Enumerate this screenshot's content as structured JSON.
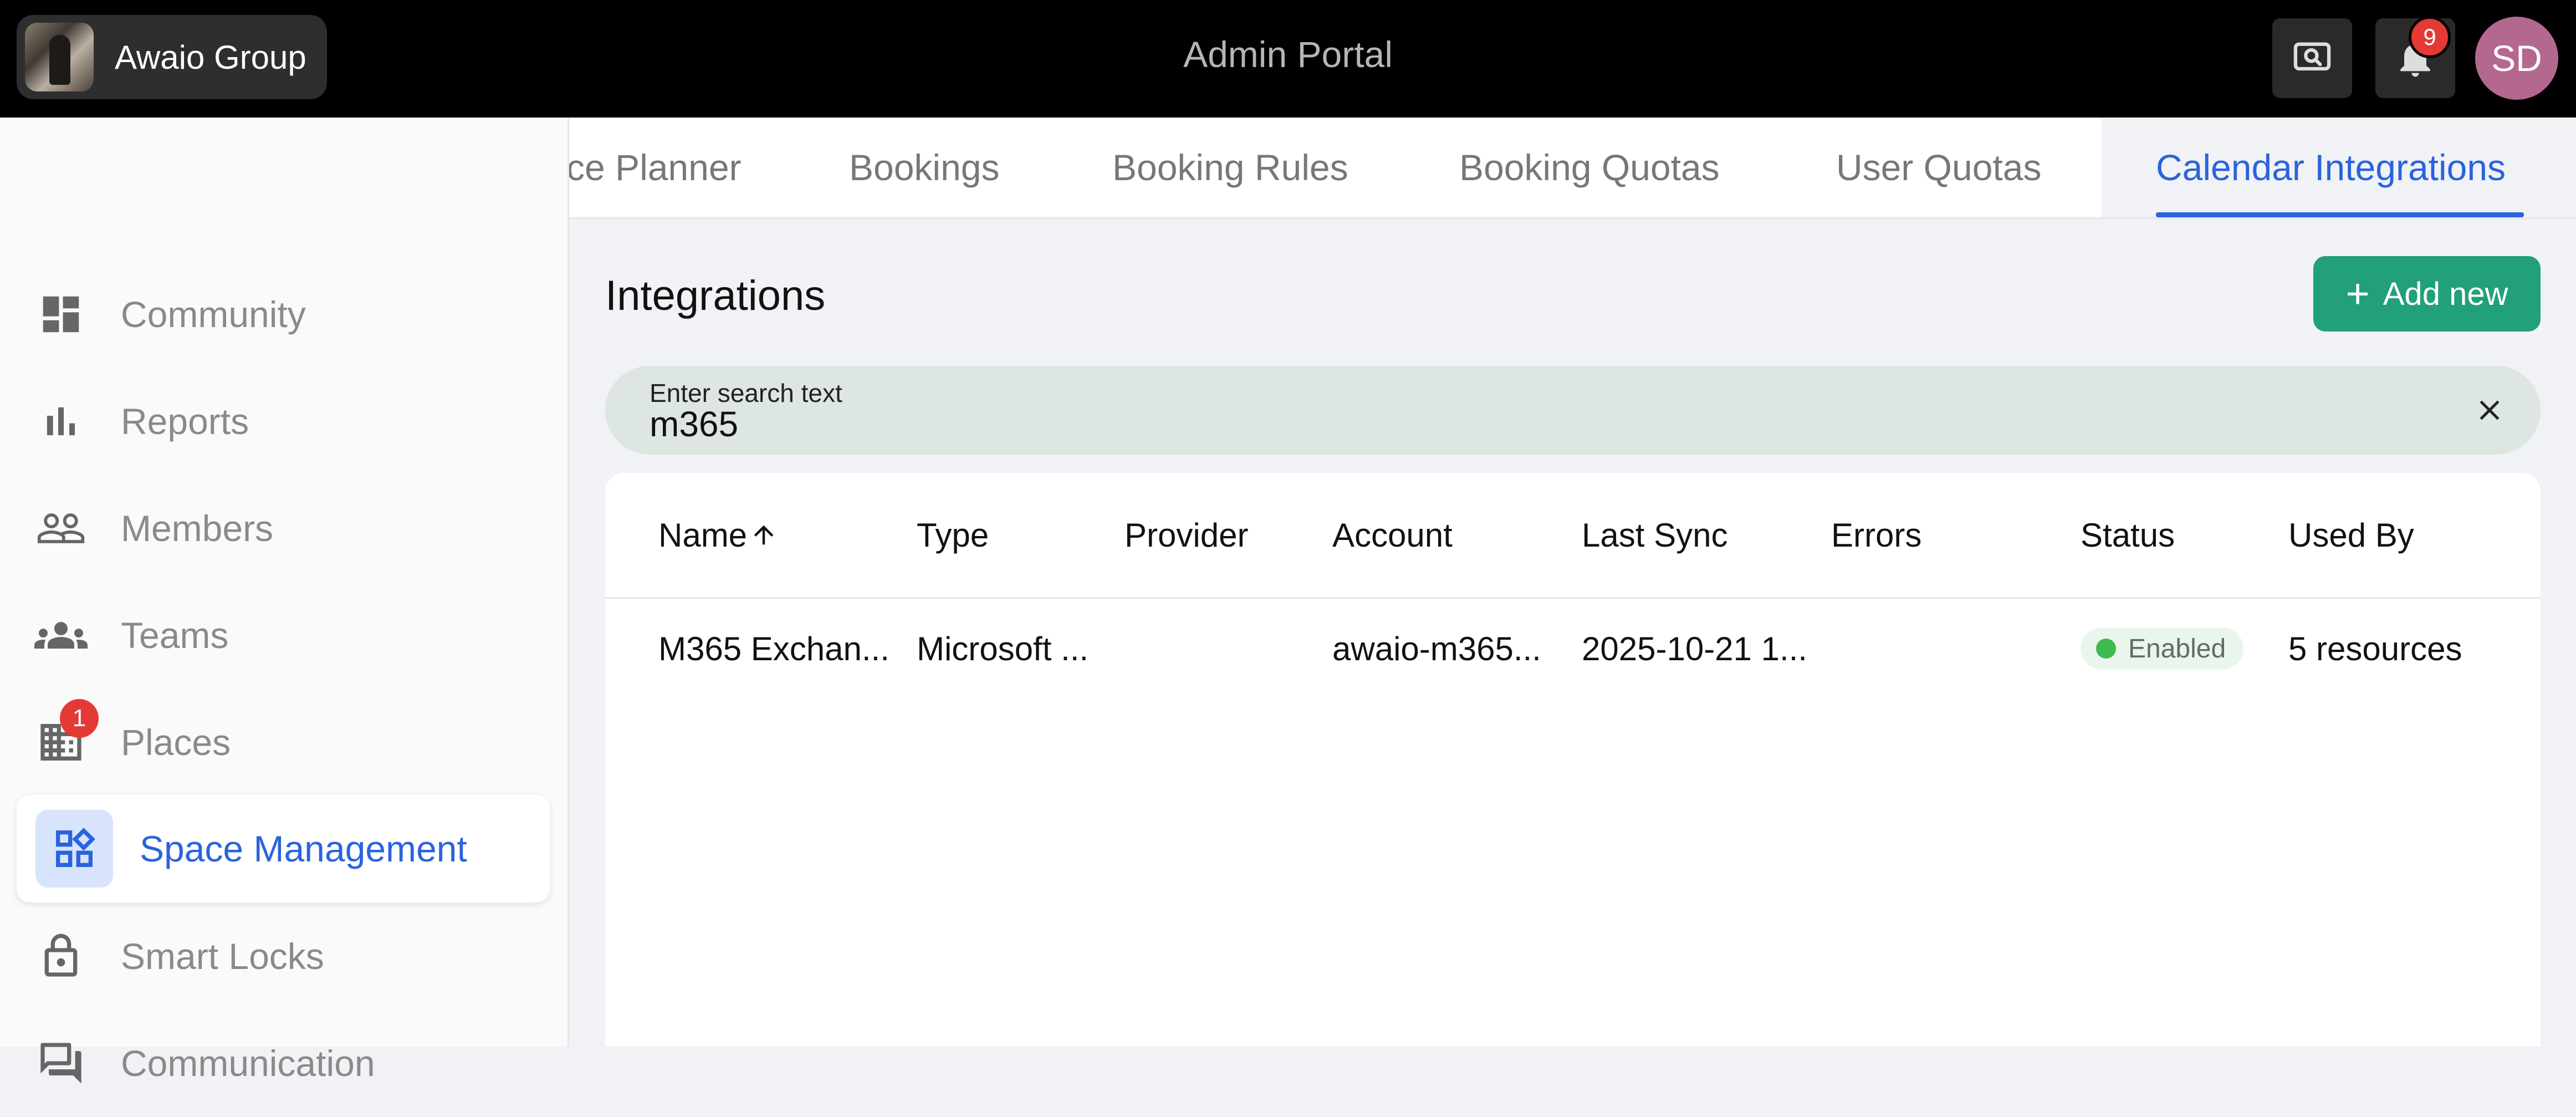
{
  "header": {
    "org_name": "Awaio Group",
    "app_title": "Admin Portal",
    "notification_count": "9",
    "user_initials": "SD"
  },
  "sidebar": {
    "items": [
      {
        "label": "Community",
        "icon": "dashboard-icon"
      },
      {
        "label": "Reports",
        "icon": "bar-chart-icon"
      },
      {
        "label": "Members",
        "icon": "people-icon"
      },
      {
        "label": "Teams",
        "icon": "groups-icon"
      },
      {
        "label": "Places",
        "icon": "building-icon",
        "badge": "1"
      },
      {
        "label": "Space Management",
        "icon": "widgets-icon",
        "active": true
      },
      {
        "label": "Smart Locks",
        "icon": "lock-icon"
      },
      {
        "label": "Communication",
        "icon": "forum-icon"
      }
    ]
  },
  "tabs": [
    {
      "label": "ce Planner"
    },
    {
      "label": "Bookings"
    },
    {
      "label": "Booking Rules"
    },
    {
      "label": "Booking Quotas"
    },
    {
      "label": "User Quotas"
    },
    {
      "label": "Calendar Integrations",
      "active": true
    }
  ],
  "main": {
    "title": "Integrations",
    "add_button": "Add new",
    "search": {
      "label": "Enter search text",
      "value": "m365"
    }
  },
  "table": {
    "columns": [
      "Name",
      "Type",
      "Provider",
      "Account",
      "Last Sync",
      "Errors",
      "Status",
      "Used By"
    ],
    "rows": [
      {
        "name": "M365 Exchan...",
        "type": "Microsoft ...",
        "provider": "",
        "account": "awaio-m365...",
        "last_sync": "2025-10-21 1...",
        "errors": "",
        "status": "Enabled",
        "used_by": "5 resources"
      }
    ]
  },
  "colors": {
    "accent": "#2a63de",
    "primary_button": "#21a079",
    "badge": "#e53935",
    "avatar": "#b5688f",
    "status_enabled": "#3fb950"
  }
}
